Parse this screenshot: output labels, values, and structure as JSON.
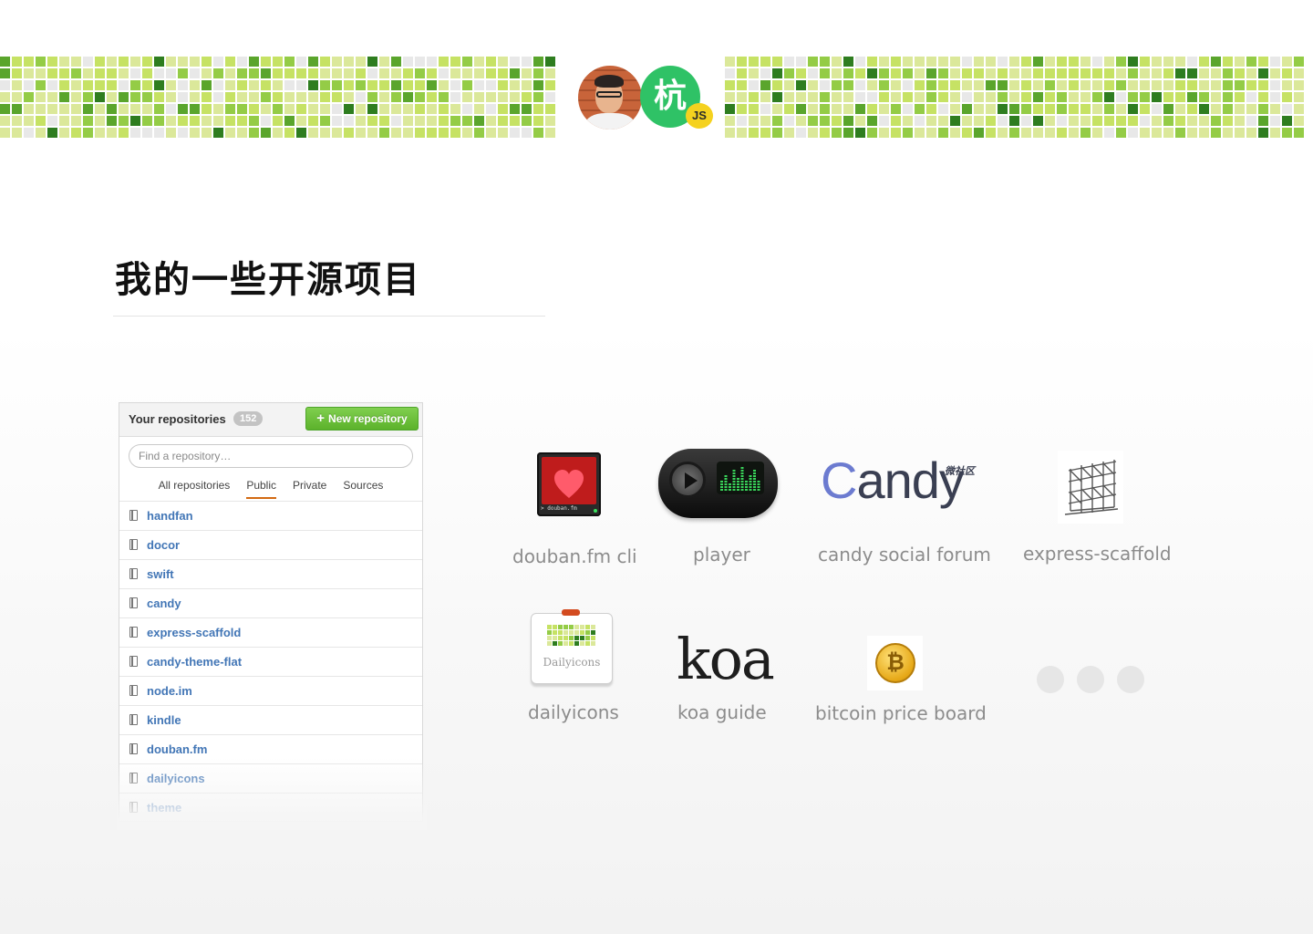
{
  "header": {
    "avatar_badge_char": "杭",
    "avatar_badge_js": "JS",
    "palette": [
      "#e8e8e8",
      "#dbe89a",
      "#c6e264",
      "#94cc46",
      "#5aa52c",
      "#2e7d1f"
    ]
  },
  "section": {
    "title": "我的一些开源项目"
  },
  "repo_panel": {
    "heading": "Your repositories",
    "count": "152",
    "new_repo_button": "New repository",
    "search_placeholder": "Find a repository…",
    "tabs": [
      "All repositories",
      "Public",
      "Private",
      "Sources"
    ],
    "active_tab": "Public",
    "repos": [
      "handfan",
      "docor",
      "swift",
      "candy",
      "express-scaffold",
      "candy-theme-flat",
      "node.im",
      "kindle",
      "douban.fm",
      "dailyicons",
      "theme"
    ]
  },
  "projects": {
    "douban_cli": {
      "label": "douban.fm cli",
      "screen_text": "> douban.fm"
    },
    "player": {
      "label": "player"
    },
    "candy": {
      "label": "candy social forum",
      "logo_text": "andy",
      "logo_c": "C",
      "logo_sub": "微社区"
    },
    "scaffold": {
      "label": "express-scaffold"
    },
    "dailyicons": {
      "label": "dailyicons",
      "card_text": "Dailyicons"
    },
    "koa": {
      "label": "koa guide",
      "logo_text": "koa"
    },
    "bitcoin": {
      "label": "bitcoin price board",
      "coin_symbol": "₿"
    }
  }
}
